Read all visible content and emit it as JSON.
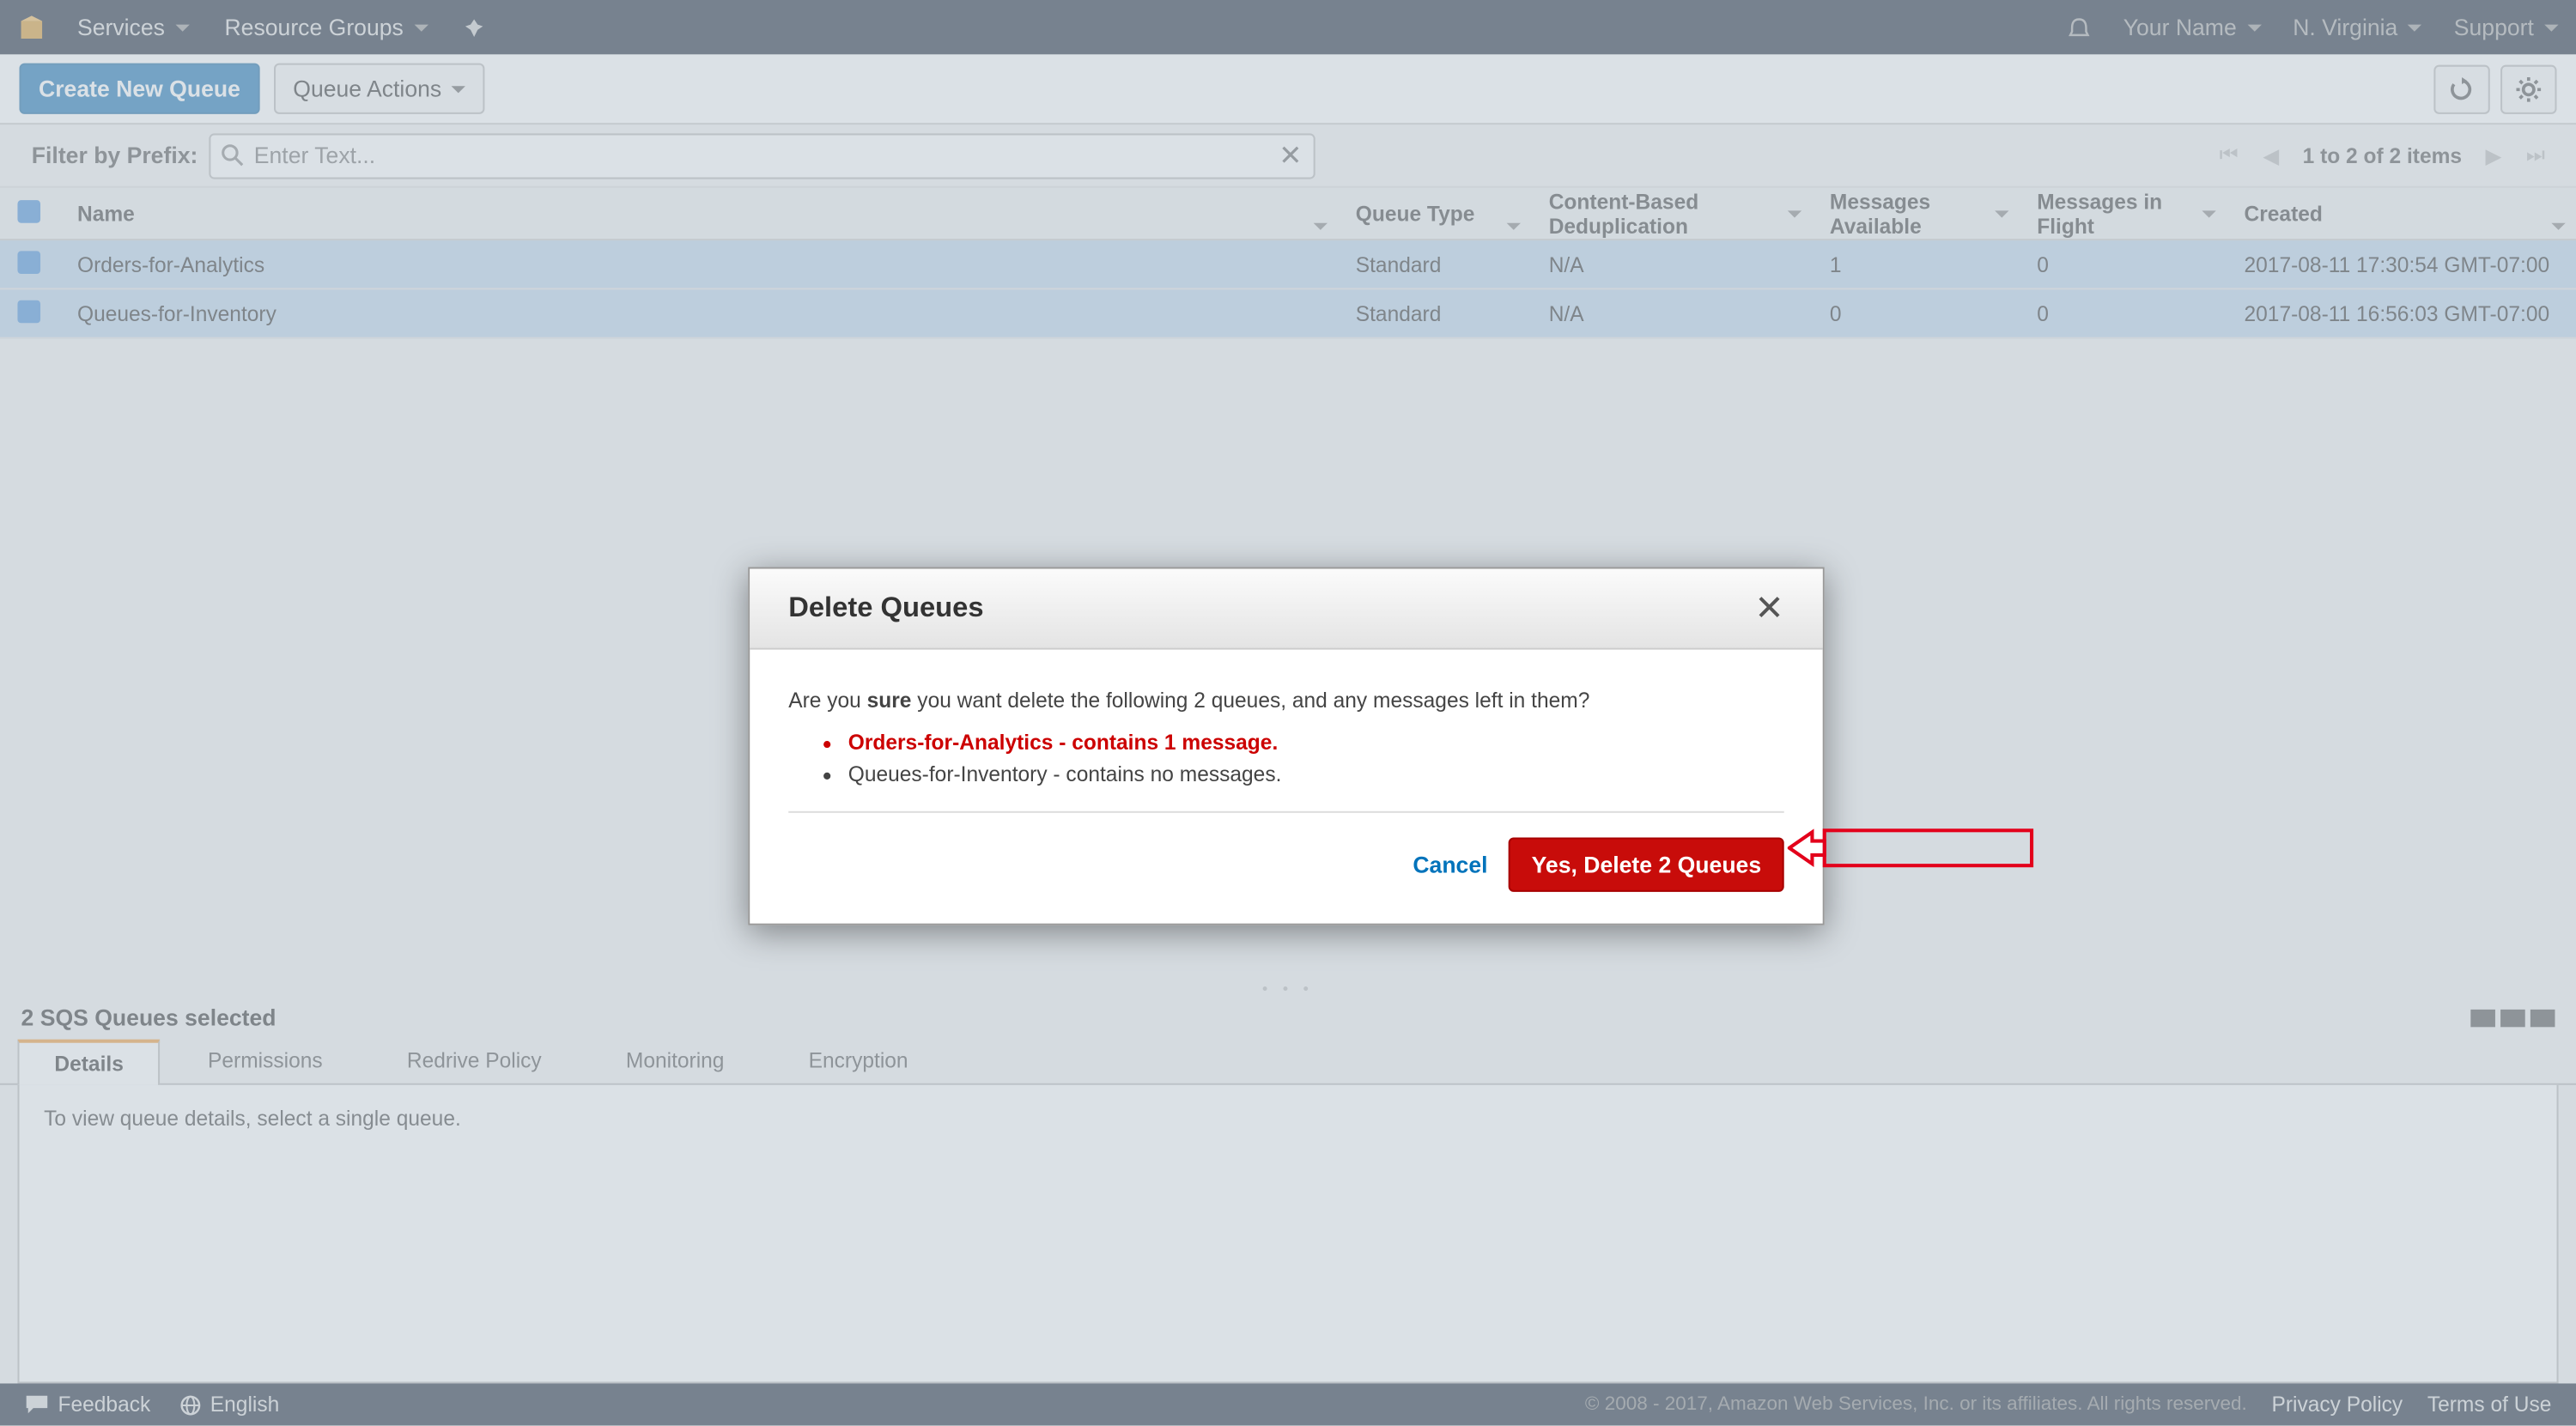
{
  "topnav": {
    "services": "Services",
    "resource_groups": "Resource Groups",
    "your_name": "Your Name",
    "region": "N. Virginia",
    "support": "Support"
  },
  "toolbar": {
    "create_queue": "Create New Queue",
    "queue_actions": "Queue Actions"
  },
  "filter": {
    "label": "Filter by Prefix:",
    "placeholder": "Enter Text..."
  },
  "paging": {
    "text": "1 to 2 of 2 items"
  },
  "columns": {
    "name": "Name",
    "queue_type": "Queue Type",
    "dedup": "Content-Based Deduplication",
    "avail": "Messages Available",
    "flight": "Messages in Flight",
    "created": "Created"
  },
  "rows": [
    {
      "name": "Orders-for-Analytics",
      "type": "Standard",
      "dedup": "N/A",
      "avail": "1",
      "flight": "0",
      "created": "2017-08-11 17:30:54 GMT-07:00"
    },
    {
      "name": "Queues-for-Inventory",
      "type": "Standard",
      "dedup": "N/A",
      "avail": "0",
      "flight": "0",
      "created": "2017-08-11 16:56:03 GMT-07:00"
    }
  ],
  "panel": {
    "selection": "2 SQS Queues selected",
    "tabs": [
      "Details",
      "Permissions",
      "Redrive Policy",
      "Monitoring",
      "Encryption"
    ],
    "body": "To view queue details, select a single queue."
  },
  "footer": {
    "feedback": "Feedback",
    "language": "English",
    "copyright": "© 2008 - 2017, Amazon Web Services, Inc. or its affiliates. All rights reserved.",
    "privacy": "Privacy Policy",
    "terms": "Terms of Use"
  },
  "modal": {
    "title": "Delete Queues",
    "prompt_pre": "Are you ",
    "prompt_bold": "sure",
    "prompt_post": " you want delete the following 2 queues, and any messages left in them?",
    "item1_name": "Orders-for-Analytics",
    "item1_msg": " - contains 1 message.",
    "item2_name": "Queues-for-Inventory",
    "item2_msg": " - contains no messages.",
    "cancel": "Cancel",
    "confirm": "Yes, Delete 2 Queues"
  }
}
